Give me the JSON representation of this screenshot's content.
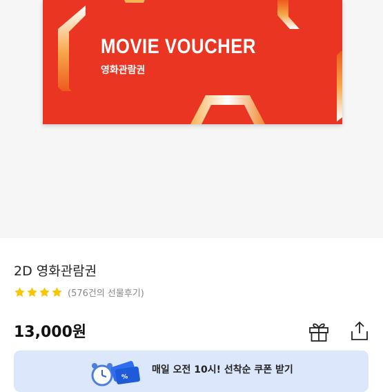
{
  "voucher": {
    "title": "MOVIE VOUCHER",
    "subtitle": "영화관람권",
    "bg_color": "#e93522",
    "accent_gradient": [
      "#ffffff",
      "#f7a64a",
      "#ee5a1e"
    ]
  },
  "product": {
    "title": "2D 영화관람권",
    "rating_stars": 4,
    "review_count_label": "(576건의 선물후기)",
    "price": "13,000원"
  },
  "actions": {
    "gift_icon": "gift-icon",
    "share_icon": "share-icon"
  },
  "coupon_banner": {
    "text": "매일 오전 10시! 선착순 쿠폰 받기",
    "bg_color": "#dde7fb",
    "icons": [
      "alarm-clock-icon",
      "coupon-ticket-icon"
    ]
  },
  "colors": {
    "star": "#f6c600",
    "price": "#111111",
    "review_text": "#888888"
  }
}
